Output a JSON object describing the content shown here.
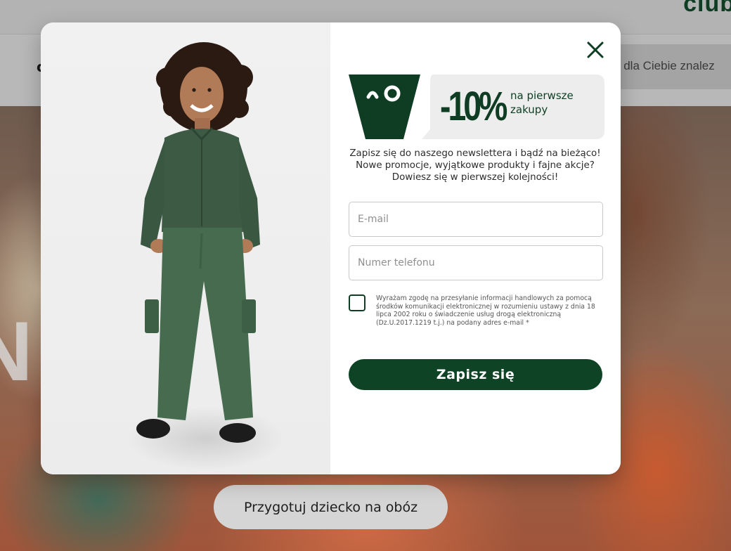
{
  "header": {
    "brand": "club"
  },
  "nav": {
    "first_letter": "c",
    "search_text": "y dla Ciebie znalez"
  },
  "hero": {
    "word": "N                    K",
    "button_label": "Przygotuj dziecko na obóz"
  },
  "modal": {
    "close_icon": "close-icon",
    "promo": {
      "logo_icon": "owl-logo-icon",
      "discount": "-10%",
      "text_line1": "na pierwsze",
      "text_line2": "zakupy"
    },
    "description": [
      "Zapisz się do naszego newslettera i bądź na bieżąco!",
      "Nowe promocje, wyjątkowe produkty i fajne akcje?",
      "Dowiesz się w pierwszej kolejności!"
    ],
    "email_placeholder": "E-mail",
    "phone_placeholder": "Numer telefonu",
    "consent_lines": [
      "Wyrażam zgodę na przesyłanie informacji handlowych za pomocą",
      "środków komunikacji elektronicznej w rozumieniu ustawy z dnia 18",
      "lipca 2002 roku o świadczenie usług drogą elektroniczną",
      "(Dz.U.2017.1219 t.j.) na podany adres e-mail *"
    ],
    "submit_label": "Zapisz się"
  },
  "colors": {
    "brand_green": "#0f3d24",
    "button_green": "#0f4326",
    "overlay": "#8a8a8a"
  }
}
